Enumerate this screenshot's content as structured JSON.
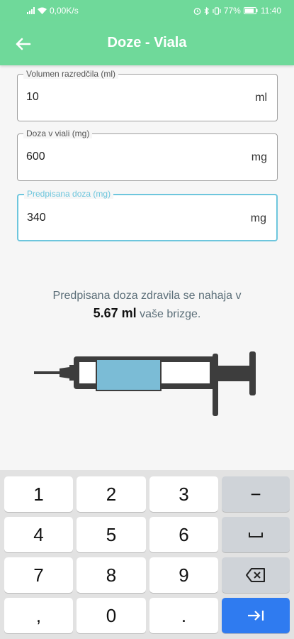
{
  "status_bar": {
    "speed": "0,00K/s",
    "battery": "77%",
    "time": "11:40"
  },
  "app_bar": {
    "title": "Doze - Viala",
    "back_icon": "arrow-left-icon"
  },
  "fields": [
    {
      "label": "Volumen razredčila (ml)",
      "value": "10",
      "unit": "ml"
    },
    {
      "label": "Doza v viali (mg)",
      "value": "600",
      "unit": "mg"
    },
    {
      "label": "Predpisana doza (mg)",
      "value": "340",
      "unit": "mg"
    }
  ],
  "result": {
    "prefix": "Predpisana doza zdravila se nahaja v",
    "amount": "5.67 ml",
    "suffix": "vaše brizge."
  },
  "syringe": {
    "fill_fraction": 0.57
  },
  "keyboard": {
    "row1": [
      "1",
      "2",
      "3",
      "−"
    ],
    "row2": [
      "4",
      "5",
      "6"
    ],
    "row3": [
      "7",
      "8",
      "9"
    ],
    "row4": [
      ",",
      "0",
      "."
    ]
  },
  "colors": {
    "accent": "#6fd99a",
    "active_field": "#6ec6dd",
    "syringe_fill": "#7bbcd6",
    "enter_key": "#2f7bf0"
  }
}
